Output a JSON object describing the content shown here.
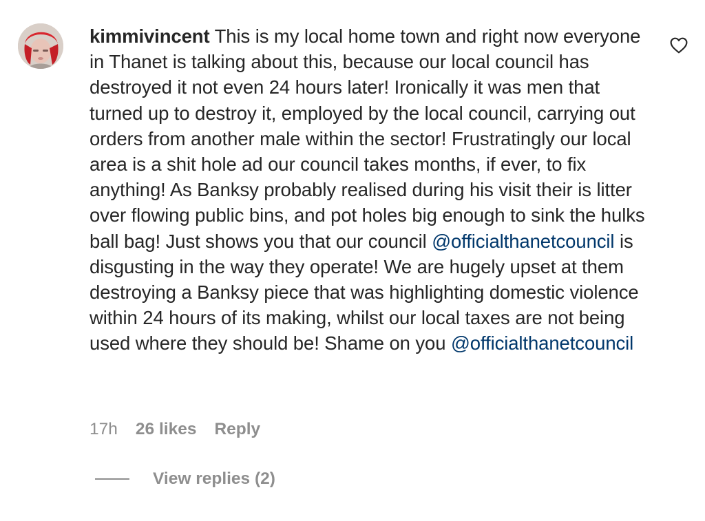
{
  "comment": {
    "username": "kimmivincent",
    "text_parts": [
      " This is my local home town and right now everyone in Thanet is talking about this, because our local council has destroyed it not even 24 hours later! Ironically it was men that turned up to destroy it, employed by the local council, carrying out orders from another male within the sector! Frustratingly our local area is a shit hole ad our council takes months, if ever, to fix anything! As Banksy probably realised during his visit their is litter over flowing public bins, and pot holes big enough to sink the hulks ball bag! Just shows you that our council ",
      "@officialthanetcouncil",
      " is disgusting in the way they operate! We are hugely upset at them destroying a Banksy piece that was highlighting domestic violence within 24 hours of its making, whilst our local taxes are not being used where they should be! Shame on you ",
      "@officialthanetcouncil"
    ],
    "time": "17h",
    "likes": "26 likes",
    "reply_label": "Reply",
    "view_replies_label": "View replies (2)",
    "like_icon": "heart-outline-icon"
  },
  "colors": {
    "text": "#262626",
    "secondary": "#8e8e8e",
    "mention": "#00376b"
  }
}
